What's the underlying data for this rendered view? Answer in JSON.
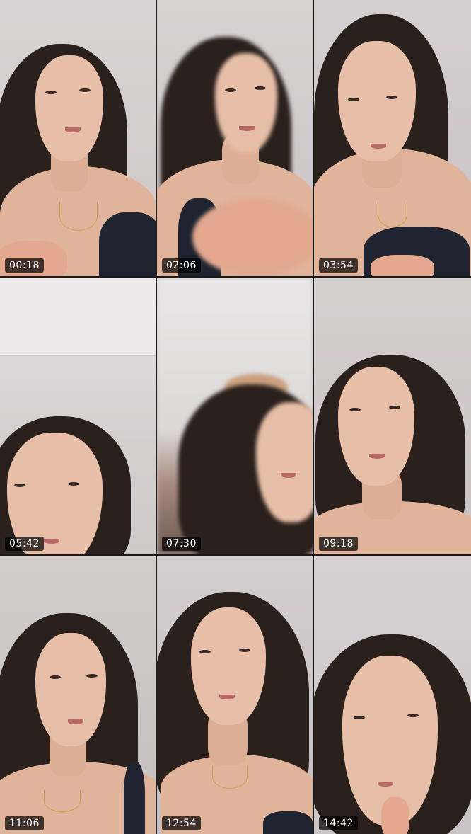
{
  "grid": {
    "columns": 3,
    "rows": 3,
    "background_color": "#1a1a1a",
    "timestamp_badge_color": "#000000",
    "timestamp_text_color": "#ffffff"
  },
  "thumbnails": [
    {
      "timestamp": "00:18"
    },
    {
      "timestamp": "02:06"
    },
    {
      "timestamp": "03:54"
    },
    {
      "timestamp": "05:42"
    },
    {
      "timestamp": "07:30"
    },
    {
      "timestamp": "09:18"
    },
    {
      "timestamp": "11:06"
    },
    {
      "timestamp": "12:54"
    },
    {
      "timestamp": "14:42"
    }
  ]
}
